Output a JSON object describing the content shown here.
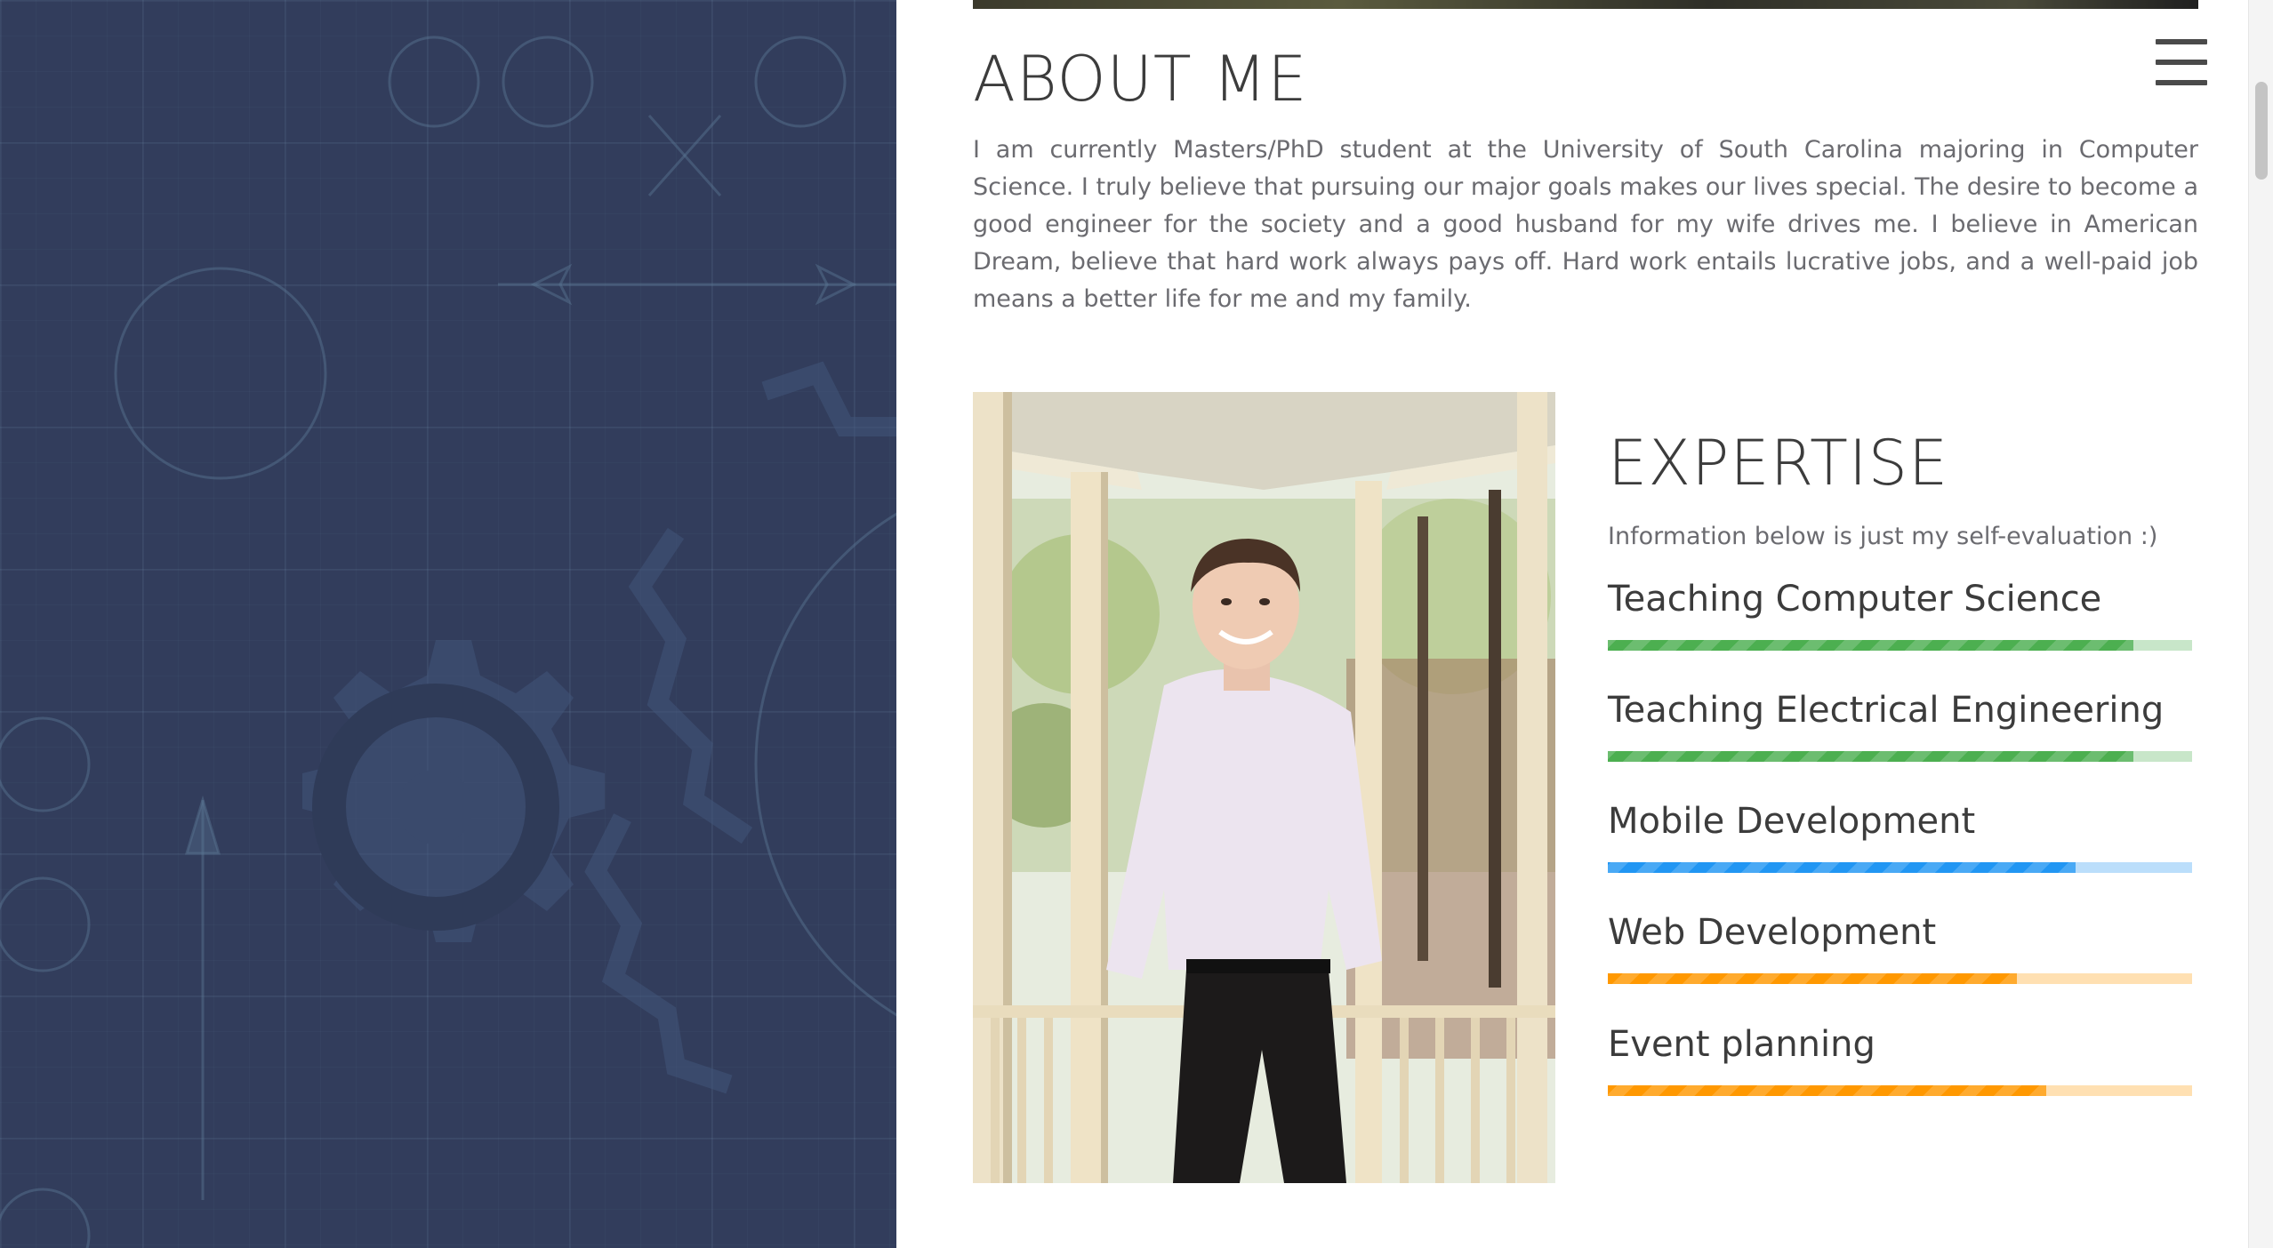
{
  "about": {
    "title": "ABOUT ME",
    "text": "I am currently Masters/PhD student at the University of South Carolina majoring in Computer Science. I truly believe that pursuing our major goals makes our lives special. The desire to become a good engineer for the society and a good husband for my wife drives me. I believe in American Dream, believe that hard work always pays off. Hard work entails lucrative jobs, and a well-paid job means a better life for me and my family."
  },
  "expertise": {
    "title": "EXPERTISE",
    "subtitle": "Information below is just my self-evaluation :)",
    "skills": [
      {
        "label": "Teaching Computer Science",
        "level": 0.9,
        "color": "#4caf50",
        "track": "#c8e6c9"
      },
      {
        "label": "Teaching Electrical Engineering",
        "level": 0.9,
        "color": "#4caf50",
        "track": "#c8e6c9"
      },
      {
        "label": "Mobile Development",
        "level": 0.8,
        "color": "#2196f3",
        "track": "#bbdefb"
      },
      {
        "label": "Web Development",
        "level": 0.7,
        "color": "#ff9800",
        "track": "#ffe0b2"
      },
      {
        "label": "Event planning",
        "level": 0.75,
        "color": "#ff9800",
        "track": "#ffe0b2"
      }
    ]
  },
  "icons": {
    "menu": "hamburger-menu-icon"
  },
  "colors": {
    "left_panel": "#323d5c",
    "heading": "#3c3c3c",
    "body_text": "#6b6b70"
  }
}
